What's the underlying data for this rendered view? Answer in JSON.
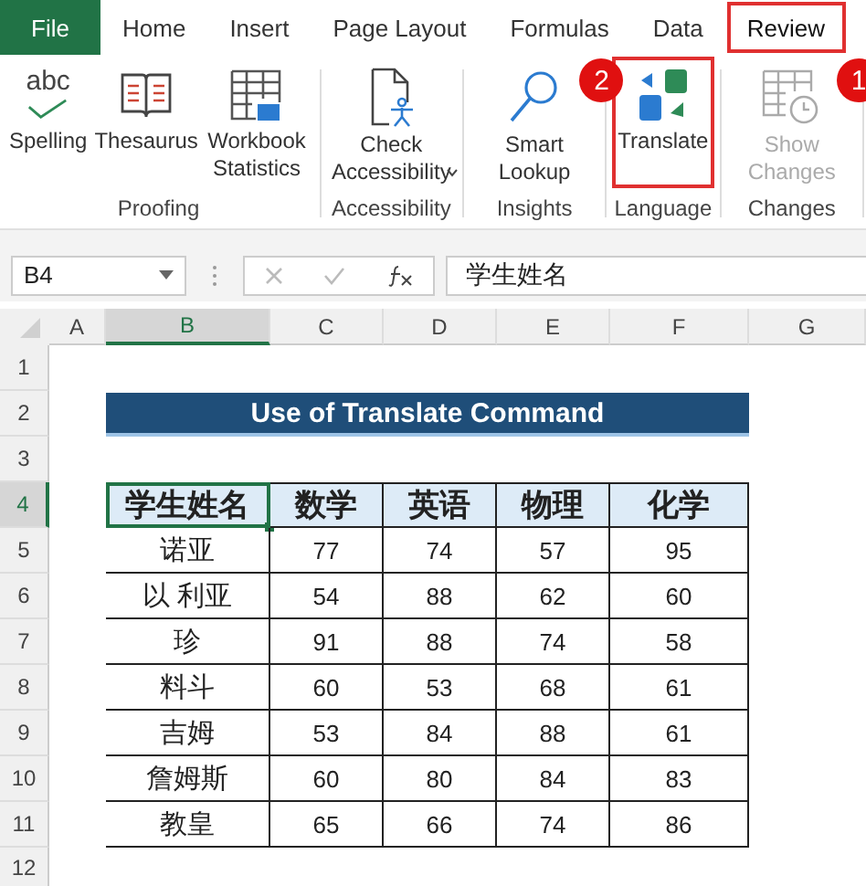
{
  "tabs": [
    {
      "label": "File",
      "kind": "file",
      "selected": false,
      "highlighted": false
    },
    {
      "label": "Home",
      "kind": "tab",
      "selected": false,
      "highlighted": false
    },
    {
      "label": "Insert",
      "kind": "tab",
      "selected": false,
      "highlighted": false
    },
    {
      "label": "Page Layout",
      "kind": "tab",
      "selected": false,
      "highlighted": false
    },
    {
      "label": "Formulas",
      "kind": "tab",
      "selected": false,
      "highlighted": false
    },
    {
      "label": "Data",
      "kind": "tab",
      "selected": false,
      "highlighted": false
    },
    {
      "label": "Review",
      "kind": "tab",
      "selected": true,
      "highlighted": true
    }
  ],
  "ribbon_groups": [
    {
      "label": "Proofing",
      "buttons": [
        {
          "label": "Spelling",
          "icon_text": "abc",
          "disabled": false,
          "highlighted": false
        },
        {
          "label": "Thesaurus",
          "disabled": false,
          "highlighted": false
        },
        {
          "label": "Workbook Statistics",
          "disabled": false,
          "highlighted": false
        }
      ]
    },
    {
      "label": "Accessibility",
      "buttons": [
        {
          "label": "Check Accessibility",
          "dropdown": true,
          "disabled": false,
          "highlighted": false
        }
      ]
    },
    {
      "label": "Insights",
      "buttons": [
        {
          "label": "Smart Lookup",
          "disabled": false,
          "highlighted": false,
          "callout": "2"
        }
      ]
    },
    {
      "label": "Language",
      "buttons": [
        {
          "label": "Translate",
          "disabled": false,
          "highlighted": true
        }
      ]
    },
    {
      "label": "Changes",
      "buttons": [
        {
          "label": "Show Changes",
          "disabled": true,
          "highlighted": false,
          "callout": "1"
        }
      ]
    }
  ],
  "formula_bar": {
    "name_box": "B4",
    "formula": "学生姓名"
  },
  "columns": [
    {
      "label": "A",
      "selected": false
    },
    {
      "label": "B",
      "selected": true
    },
    {
      "label": "C",
      "selected": false
    },
    {
      "label": "D",
      "selected": false
    },
    {
      "label": "E",
      "selected": false
    },
    {
      "label": "F",
      "selected": false
    },
    {
      "label": "G",
      "selected": false
    }
  ],
  "rows": [
    {
      "label": "1",
      "selected": false
    },
    {
      "label": "2",
      "selected": false
    },
    {
      "label": "3",
      "selected": false
    },
    {
      "label": "4",
      "selected": true
    },
    {
      "label": "5",
      "selected": false
    },
    {
      "label": "6",
      "selected": false
    },
    {
      "label": "7",
      "selected": false
    },
    {
      "label": "8",
      "selected": false
    },
    {
      "label": "9",
      "selected": false
    },
    {
      "label": "10",
      "selected": false
    },
    {
      "label": "11",
      "selected": false
    },
    {
      "label": "12",
      "selected": false
    }
  ],
  "title": "Use of Translate Command",
  "table": {
    "header": [
      {
        "text": "学生姓名",
        "selected": true
      },
      {
        "text": "数学",
        "selected": false
      },
      {
        "text": "英语",
        "selected": false
      },
      {
        "text": "物理",
        "selected": false
      },
      {
        "text": "化学",
        "selected": false
      }
    ],
    "rows": [
      [
        "诺亚",
        "77",
        "74",
        "57",
        "95"
      ],
      [
        "以 利亚",
        "54",
        "88",
        "62",
        "60"
      ],
      [
        "珍",
        "91",
        "88",
        "74",
        "58"
      ],
      [
        "料斗",
        "60",
        "53",
        "68",
        "61"
      ],
      [
        "吉姆",
        "53",
        "84",
        "88",
        "61"
      ],
      [
        "詹姆斯",
        "60",
        "80",
        "84",
        "83"
      ],
      [
        "教皇",
        "65",
        "66",
        "74",
        "86"
      ]
    ]
  }
}
